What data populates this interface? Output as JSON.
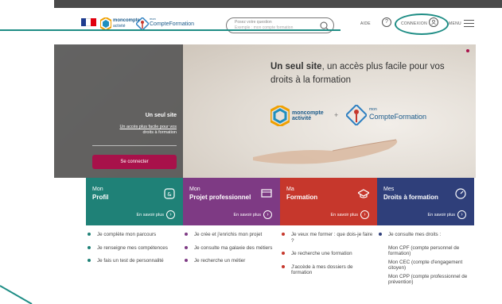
{
  "header": {
    "search_placeholder_line1": "Posez votre question",
    "search_placeholder_line2": "Exemple : mon compte formation",
    "aide_label": "AIDE",
    "aide_icon_glyph": "?",
    "connexion_label": "CONNEXION",
    "menu_label": "MENU",
    "logo1_line1": "moncompte",
    "logo1_line2": "activité",
    "logo2_sup": "mon",
    "logo2_text": "CompteFormation",
    "flag_caption": "République Française"
  },
  "hero": {
    "headline_bold": "Un seul site",
    "headline_rest": ", un accès plus facile pour vos droits à la formation",
    "brand_a_line1": "moncompte",
    "brand_a_line2": "activité",
    "brand_plus": "+",
    "brand_b_sup": "mon",
    "brand_b_text": "CompteFormation",
    "panel_title": "Un seul site",
    "panel_link_line1": "Un accès plus facile pour vos",
    "panel_link_line2": "droits à formation",
    "connect_button": "Se connecter"
  },
  "tiles": [
    {
      "line1": "Mon",
      "line2": "Profil",
      "more": "En savoir plus",
      "icon": "id-card-icon",
      "color": "#1f8177"
    },
    {
      "line1": "Mon",
      "line2": "Projet professionnel",
      "more": "En savoir plus",
      "icon": "screen-icon",
      "color": "#7e3a84"
    },
    {
      "line1": "Ma",
      "line2": "Formation",
      "more": "En savoir plus",
      "icon": "graduation-cap-icon",
      "color": "#c6372c"
    },
    {
      "line1": "Mes",
      "line2": "Droits à formation",
      "more": "En savoir plus",
      "icon": "gauge-icon",
      "color": "#2f3f7a"
    }
  ],
  "columns": {
    "profil": [
      "Je complète mon parcours",
      "Je renseigne mes compétences",
      "Je fais un test de personnalité"
    ],
    "projet": [
      "Je crée et j'enrichis mon projet",
      "Je consulte ma galaxie des métiers",
      "Je recherche un métier"
    ],
    "formation": [
      "Je veux me former : que dois-je faire ?",
      "Je recherche une formation",
      "J'accède à mes dossiers de formation"
    ],
    "droits_head": "Je consulte mes droits :",
    "droits_sub": [
      "Mon CPF (compte personnel de formation)",
      "Mon CEC (compte d'engagement citoyen)",
      "Mon CPP (compte professionnel de prévention)"
    ]
  },
  "colors": {
    "annotation": "#1e8d85",
    "connect_button": "#a8114a"
  }
}
